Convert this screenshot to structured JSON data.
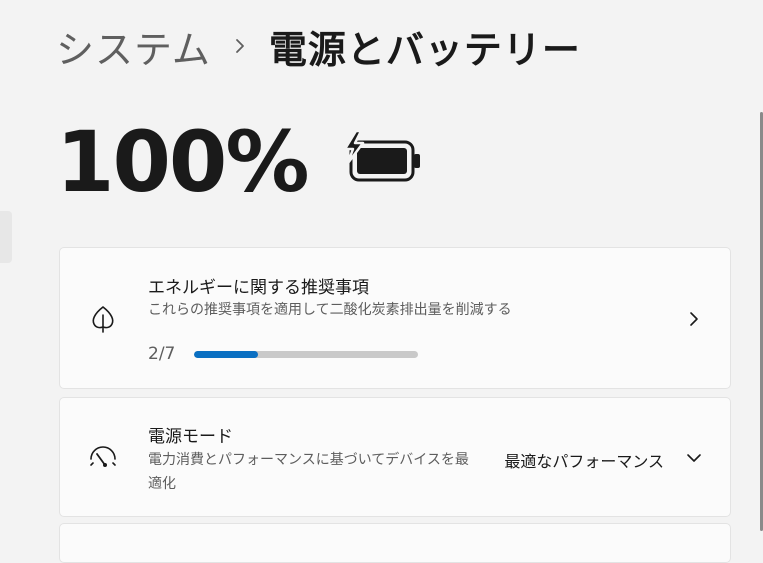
{
  "breadcrumb": {
    "parent": "システム",
    "current": "電源とバッテリー"
  },
  "battery": {
    "percent_label": "100%",
    "icon": "battery-charging-icon"
  },
  "energy_recommendations": {
    "icon": "leaf-icon",
    "title": "エネルギーに関する推奨事項",
    "description": "これらの推奨事項を適用して二酸化炭素排出量を削減する",
    "progress_label": "2/7",
    "progress_value": 0.2857,
    "progress_color": "#0a6fc2"
  },
  "power_mode": {
    "icon": "gauge-icon",
    "title": "電源モード",
    "description": "電力消費とパフォーマンスに基づいてデバイスを最適化",
    "selected_value": "最適なパフォーマンス"
  }
}
